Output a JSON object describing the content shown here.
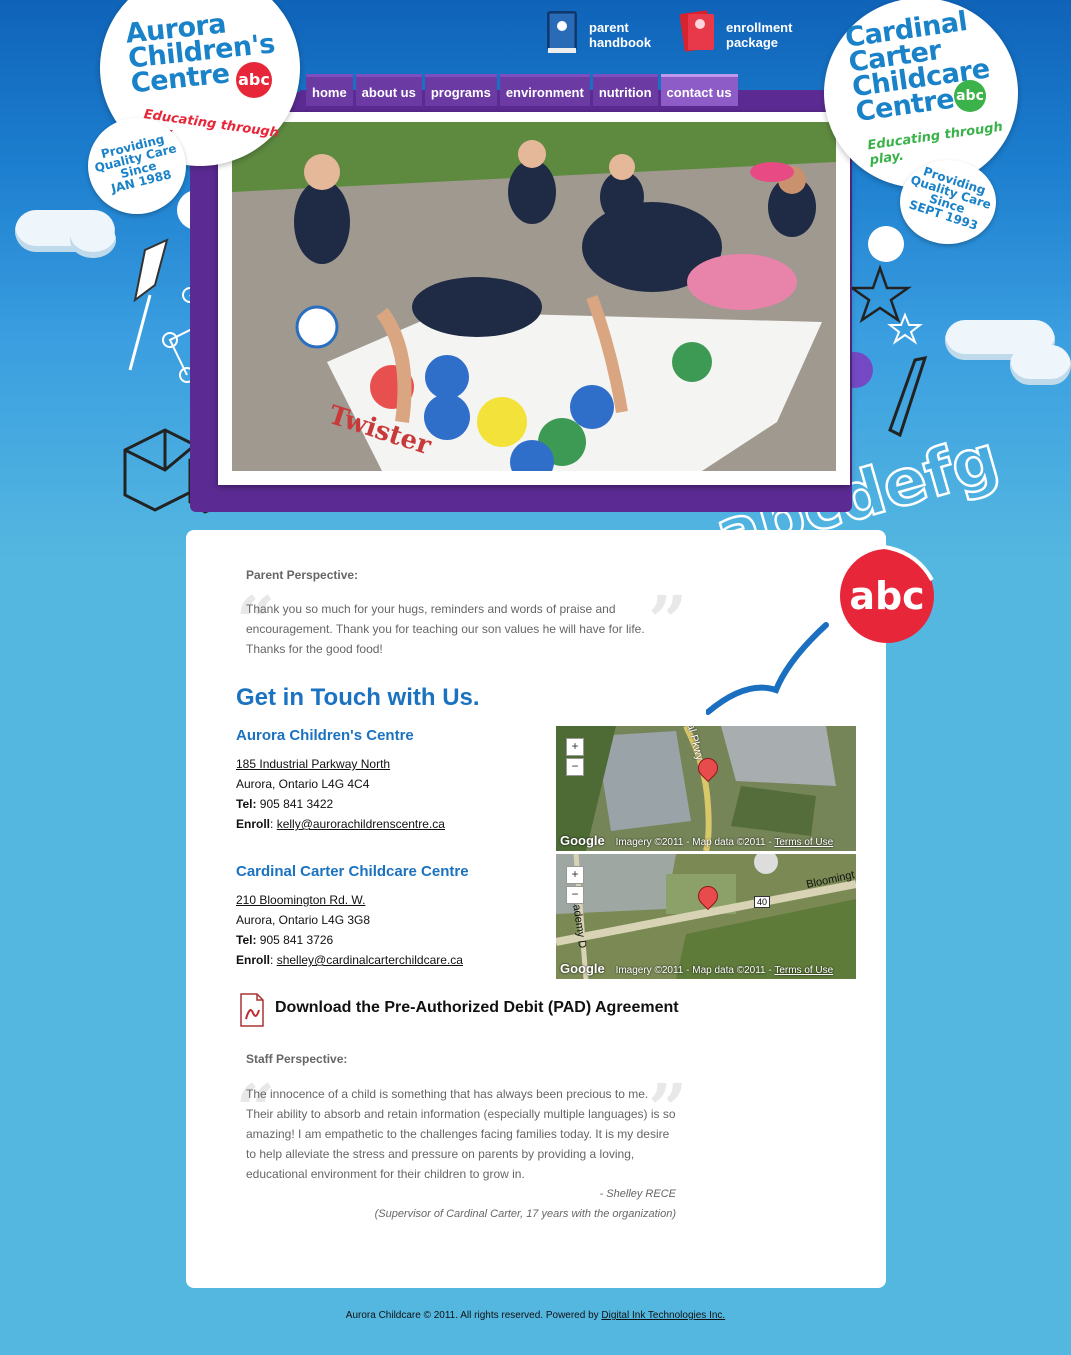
{
  "header": {
    "aurora_logo": {
      "line1": "Aurora",
      "line2": "Children's",
      "line3": "Centre",
      "badge": "abc",
      "tagline": "Educating through play."
    },
    "aurora_since": {
      "line1": "Providing",
      "line2": "Quality Care",
      "line3": "Since",
      "line4": "JAN 1988"
    },
    "cardinal_logo": {
      "line1": "Cardinal",
      "line2": "Carter",
      "line3": "Childcare",
      "line4": "Centre",
      "badge": "abc",
      "tagline": "Educating through play."
    },
    "cardinal_since": {
      "line1": "Providing",
      "line2": "Quality Care",
      "line3": "Since",
      "line4": "SEPT 1993"
    },
    "parent_handbook": {
      "line1": "parent",
      "line2": "handbook"
    },
    "enrollment_package": {
      "line1": "enrollment",
      "line2": "package"
    },
    "letters_art": "abcdefg"
  },
  "nav": {
    "items": [
      "home",
      "about us",
      "programs",
      "environment",
      "nutrition",
      "contact us"
    ],
    "active": "contact us"
  },
  "content": {
    "parent_perspective": {
      "label": "Parent Perspective:",
      "lines": [
        "Thank you so much for your hugs, reminders and words of praise and",
        "encouragement. Thank you for teaching our son values he will have for life.",
        "Thanks for the good food!"
      ]
    },
    "abc_badge": "abc",
    "contact_heading": "Get in Touch with Us.",
    "locations": [
      {
        "name": "Aurora Children's Centre",
        "address": "185 Industrial Parkway North",
        "city": "Aurora, Ontario L4G 4C4",
        "tel_label": "Tel:",
        "tel": " 905 841 3422",
        "enroll_label": "Enroll",
        "enroll_sep": ": ",
        "email": "kelly@aurorachildrenscentre.ca",
        "map": {
          "road": "al Pkwy",
          "logo": "Google",
          "imagery": "Imagery ©2011",
          "mapdata": "Map data ©2011",
          "sep": " - ",
          "terms": "Terms of Use"
        }
      },
      {
        "name": "Cardinal Carter Childcare Centre",
        "address": "210 Bloomington Rd. W.",
        "city": "Aurora, Ontario L4G 3G8",
        "tel_label": "Tel:",
        "tel": " 905 841 3726",
        "enroll_label": "Enroll",
        "enroll_sep": ": ",
        "email": "shelley@cardinalcarterchildcare.ca",
        "map": {
          "road": "Bloomingt",
          "road2": "Academy D",
          "shield": "40",
          "logo": "Google",
          "imagery": "Imagery ©2011",
          "mapdata": "Map data ©2011",
          "sep": " - ",
          "terms": "Terms of Use"
        }
      }
    ],
    "pad_download": "Download the Pre-Authorized Debit (PAD) Agreement",
    "staff_perspective": {
      "label": "Staff Perspective:",
      "lines": [
        "The innocence of a child is something that has always been precious to me.",
        "Their ability to absorb and retain information (especially multiple languages) is so",
        "amazing! I am empathetic to the challenges facing families today. It is my desire",
        "to help alleviate the stress and pressure on parents by providing a loving,",
        "educational environment for their children to grow in."
      ],
      "author": "- Shelley RECE",
      "role": "(Supervisor of Cardinal Carter, 17 years with the organization)"
    }
  },
  "footer": {
    "text": "Aurora Childcare © 2011. All rights reserved. Powered by ",
    "link": "Digital Ink Technologies Inc."
  },
  "colors": {
    "brand_blue": "#1a82c8",
    "purple": "#5b2b93",
    "accent_red": "#e8263a",
    "accent_green": "#3bb24a",
    "background": "#54b7e0"
  },
  "icons": [
    "handbook-icon",
    "enrollment-package-icon",
    "pdf-icon",
    "map-pin-icon",
    "zoom-in-icon",
    "zoom-out-icon",
    "quote-open-icon",
    "quote-close-icon"
  ]
}
